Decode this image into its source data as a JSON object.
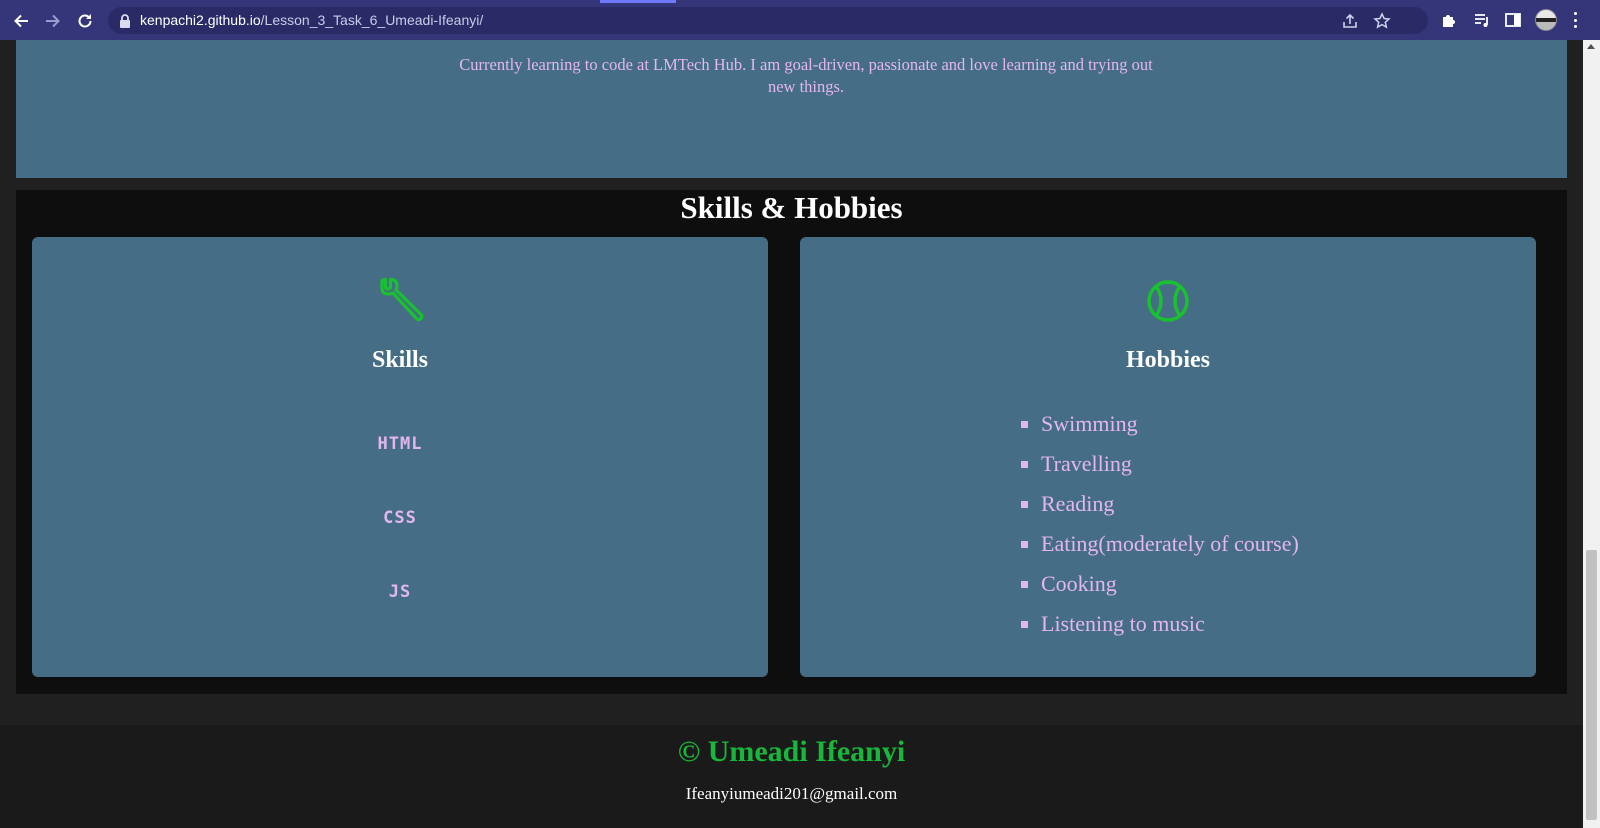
{
  "browser": {
    "url_host": "kenpachi2.github.io",
    "url_path": "/Lesson_3_Task_6_Umeadi-Ifeanyi/",
    "icons": [
      "back-arrow-icon",
      "forward-arrow-icon",
      "reload-icon",
      "lock-icon",
      "share-icon",
      "star-icon",
      "puzzle-icon",
      "media-queue-icon",
      "side-panel-icon",
      "profile-avatar",
      "more-menu-icon"
    ]
  },
  "about": {
    "text": "Currently learning to code at LMTech Hub. I am goal-driven, passionate and love learning and trying out new things."
  },
  "skills_section": {
    "title": "Skills & Hobbies",
    "skills_card": {
      "icon": "wrench-icon",
      "title": "Skills",
      "items": [
        "html",
        "css",
        "js"
      ]
    },
    "hobbies_card": {
      "icon": "tennis-ball-icon",
      "title": "Hobbies",
      "items": [
        "Swimming",
        "Travelling",
        "Reading",
        "Eating(moderately of course)",
        "Cooking",
        "Listening to music"
      ]
    }
  },
  "footer": {
    "name": "© Umeadi Ifeanyi",
    "email": "Ifeanyiumeadi201@gmail.com"
  },
  "colors": {
    "chrome_bg": "#35367a",
    "panel_bg": "#466d86",
    "section_bg": "#0e0e0e",
    "accent_text": "#e3b6f0",
    "footer_name": "#18b63a",
    "icon_green": "#18c22e"
  }
}
